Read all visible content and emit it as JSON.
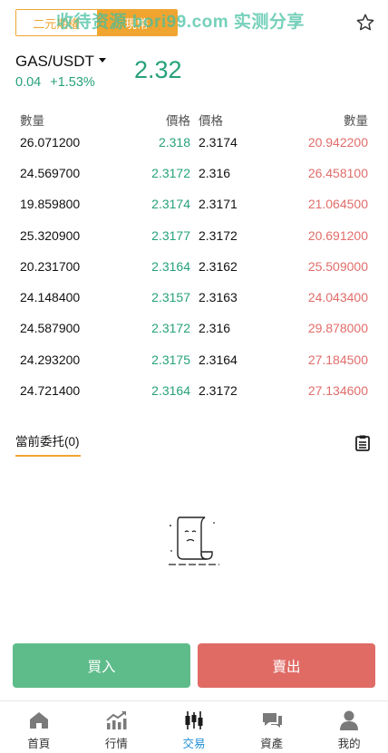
{
  "header": {
    "seg_option_1": "二元期權",
    "seg_option_2": "現幣",
    "watermark": "收待资源 bori99.com 实测分享"
  },
  "ticker": {
    "pair": "GAS/USDT",
    "price": "2.32",
    "change_abs": "0.04",
    "change_pct": "+1.53%"
  },
  "orderbook": {
    "headers": {
      "qty_left": "數量",
      "price_left": "價格",
      "price_right": "價格",
      "qty_right": "數量"
    },
    "rows": [
      {
        "bid_qty": "26.071200",
        "bid_price": "2.318",
        "ask_price": "2.3174",
        "ask_qty": "20.942200"
      },
      {
        "bid_qty": "24.569700",
        "bid_price": "2.3172",
        "ask_price": "2.316",
        "ask_qty": "26.458100"
      },
      {
        "bid_qty": "19.859800",
        "bid_price": "2.3174",
        "ask_price": "2.3171",
        "ask_qty": "21.064500"
      },
      {
        "bid_qty": "25.320900",
        "bid_price": "2.3177",
        "ask_price": "2.3172",
        "ask_qty": "20.691200"
      },
      {
        "bid_qty": "20.231700",
        "bid_price": "2.3164",
        "ask_price": "2.3162",
        "ask_qty": "25.509000"
      },
      {
        "bid_qty": "24.148400",
        "bid_price": "2.3157",
        "ask_price": "2.3163",
        "ask_qty": "24.043400"
      },
      {
        "bid_qty": "24.587900",
        "bid_price": "2.3172",
        "ask_price": "2.316",
        "ask_qty": "29.878000"
      },
      {
        "bid_qty": "24.293200",
        "bid_price": "2.3175",
        "ask_price": "2.3164",
        "ask_qty": "27.184500"
      },
      {
        "bid_qty": "24.721400",
        "bid_price": "2.3164",
        "ask_price": "2.3172",
        "ask_qty": "27.134600"
      }
    ]
  },
  "orders": {
    "tab_label": "當前委托(0)"
  },
  "actions": {
    "buy_label": "買入",
    "sell_label": "賣出"
  },
  "tabbar": {
    "items": [
      {
        "label": "首頁",
        "icon": "home-icon"
      },
      {
        "label": "行情",
        "icon": "market-chart-icon"
      },
      {
        "label": "交易",
        "icon": "candlestick-icon",
        "active": true
      },
      {
        "label": "資產",
        "icon": "wallet-icon"
      },
      {
        "label": "我的",
        "icon": "user-icon"
      }
    ]
  },
  "colors": {
    "accent": "#f0a530",
    "up": "#26a17b",
    "down": "#e06d6a",
    "buy_button": "#5ebc8a",
    "sell_button": "#e06b65",
    "tab_active": "#1f8ed6"
  }
}
